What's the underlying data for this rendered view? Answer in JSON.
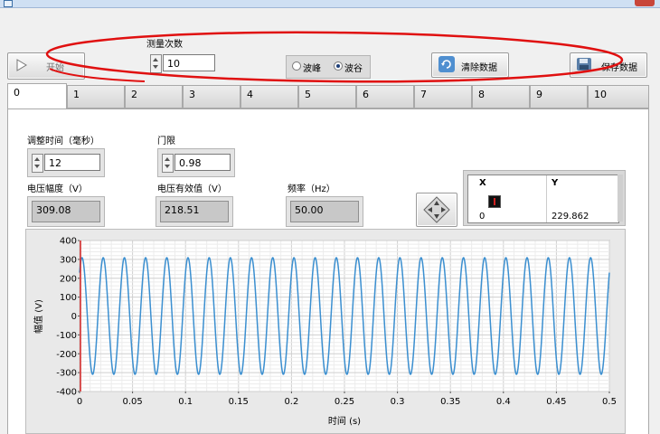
{
  "toolbar": {
    "start_label": "开始",
    "count_label": "测量次数",
    "count_value": "10",
    "mode_options": [
      "波峰",
      "波谷"
    ],
    "mode_selected": "波谷",
    "clear_label": "清除数据",
    "save_label": "保存数据"
  },
  "tabs": [
    "0",
    "1",
    "2",
    "3",
    "4",
    "5",
    "6",
    "7",
    "8",
    "9",
    "10"
  ],
  "active_tab": "0",
  "controls": {
    "adjust_time_label": "调整时间（毫秒）",
    "adjust_time_value": "12",
    "threshold_label": "门限",
    "threshold_value": "0.98",
    "amplitude_label": "电压幅度（V）",
    "amplitude_value": "309.08",
    "rms_label": "电压有效值（V）",
    "rms_value": "218.51",
    "freq_label": "频率（Hz）",
    "freq_value": "50.00"
  },
  "xy_table": {
    "headers": [
      "X",
      "Y"
    ],
    "x_value": "0",
    "y_value": "229.862"
  },
  "chart_data": {
    "type": "line",
    "xlabel": "时间 (s)",
    "ylabel": "幅值 (V)",
    "xlim": [
      0,
      0.5
    ],
    "ylim": [
      -400,
      400
    ],
    "xticks": [
      "0",
      "0.05",
      "0.1",
      "0.15",
      "0.2",
      "0.25",
      "0.3",
      "0.35",
      "0.4",
      "0.45",
      "0.5"
    ],
    "yticks": [
      "400",
      "300",
      "200",
      "100",
      "0",
      "-100",
      "-200",
      "-300",
      "-400"
    ],
    "grid": true,
    "series": [
      {
        "amplitude": 309.08,
        "frequency_hz": 50,
        "phase_deg": 48,
        "color": "#3b8fd0"
      }
    ],
    "cursor_x": 0,
    "cursor_color": "#d22020"
  },
  "colors": {
    "annotation": "#e01010",
    "wave": "#3b8fd0"
  }
}
